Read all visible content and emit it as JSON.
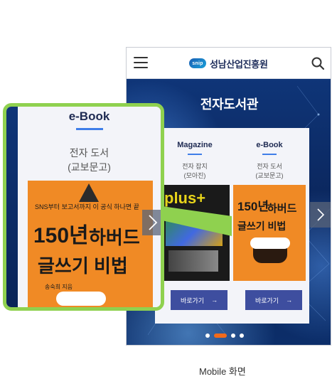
{
  "header": {
    "logo_mark": "snip",
    "title": "성남산업진흥원"
  },
  "section_title": "전자도서관",
  "cards": [
    {
      "title": "Magazine",
      "sub1": "전자 잡지",
      "sub2": "(모아진)",
      "button": "바로가기",
      "cover_text": "plus+"
    },
    {
      "title": "e-Book",
      "sub1": "전자 도서",
      "sub2": "(교보문고)",
      "button": "바로가기",
      "cover_text1": "150년",
      "cover_text2": "하버드",
      "cover_text3": "글쓰기 비법"
    }
  ],
  "zoom": {
    "title": "e-Book",
    "sub1": "전자 도서",
    "sub2": "(교보문고)",
    "cover_top": "SNS부터 보고서까지 이 공식 하나면 끝",
    "cover_text1": "150년",
    "cover_text2": "하버드",
    "cover_text3": "글쓰기 비법",
    "author": "송숙희 지음"
  },
  "pagination": {
    "count": 4,
    "active_index": 1
  },
  "caption": "Mobile 화면",
  "colors": {
    "accent_green": "#8fd14f",
    "navy": "#0b2a63",
    "button": "#3e4e9f",
    "orange": "#f08a25",
    "dot_active": "#f26a1b"
  }
}
